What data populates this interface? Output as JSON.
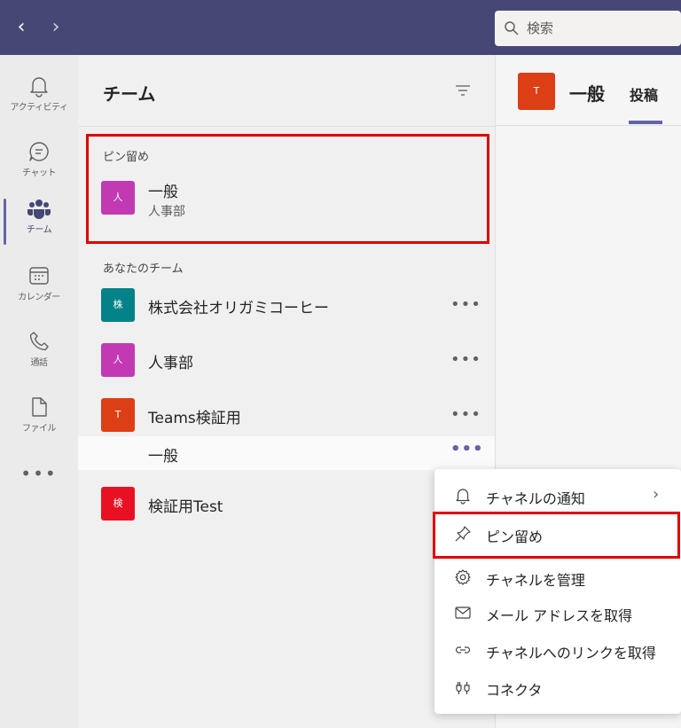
{
  "topbar": {
    "back_glyph": "‹",
    "forward_glyph": "›",
    "search_placeholder": "検索",
    "bg_color": "#464775"
  },
  "rail": {
    "items": [
      {
        "label": "アクティビティ",
        "icon": "bell-icon"
      },
      {
        "label": "チャット",
        "icon": "chat-icon"
      },
      {
        "label": "チーム",
        "icon": "teams-icon",
        "active": true
      },
      {
        "label": "カレンダー",
        "icon": "calendar-icon"
      },
      {
        "label": "通話",
        "icon": "phone-icon"
      },
      {
        "label": "ファイル",
        "icon": "file-icon"
      }
    ],
    "more": "•••"
  },
  "panel": {
    "title": "チーム",
    "pinned_label": "ピン留め",
    "pinned": {
      "name": "一般",
      "sub": "人事部",
      "avatar_letter": "人",
      "avatar_color": "#c239b3"
    },
    "your_teams_label": "あなたのチーム",
    "teams": [
      {
        "name": "株式会社オリガミコーヒー",
        "avatar_letter": "株",
        "avatar_color": "#038387"
      },
      {
        "name": "人事部",
        "avatar_letter": "人",
        "avatar_color": "#c239b3"
      },
      {
        "name": "Teams検証用",
        "avatar_letter": "T",
        "avatar_color": "#dc3e15"
      },
      {
        "name": "検証用Test",
        "avatar_letter": "検",
        "avatar_color": "#e81123"
      }
    ],
    "channel": {
      "name": "一般"
    },
    "more_glyph": "•••"
  },
  "channel_pane": {
    "avatar_letter": "T",
    "title": "一般",
    "tab": "投稿"
  },
  "menu": {
    "items": [
      {
        "label": "チャネルの通知",
        "icon": "bell-outline-icon",
        "has_submenu": true
      },
      {
        "label": "ピン留め",
        "icon": "pin-icon"
      },
      {
        "label": "チャネルを管理",
        "icon": "gear-icon"
      },
      {
        "label": "メール アドレスを取得",
        "icon": "mail-icon"
      },
      {
        "label": "チャネルへのリンクを取得",
        "icon": "link-icon"
      },
      {
        "label": "コネクタ",
        "icon": "connector-icon"
      }
    ],
    "chevron": "›"
  },
  "colors": {
    "accent": "#6264a7",
    "highlight": "#e00000"
  }
}
